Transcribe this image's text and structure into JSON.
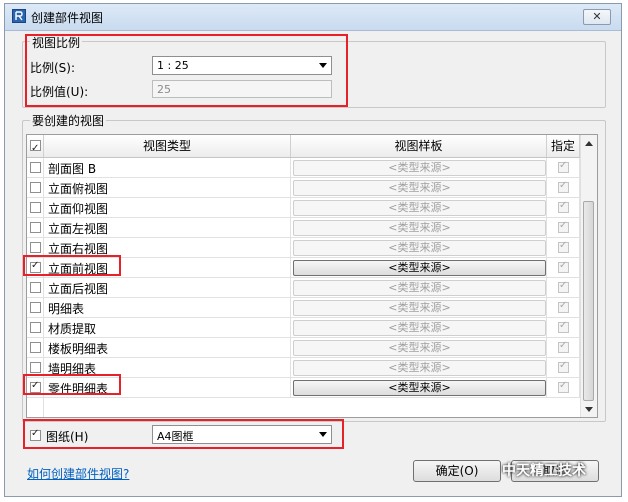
{
  "window": {
    "title": "创建部件视图",
    "close_glyph": "✕"
  },
  "scale_group": {
    "legend": "视图比例",
    "scale_label": "比例(S):",
    "scale_value": "1 : 25",
    "scale_value_label": "比例值(U):",
    "scale_value_text": "25"
  },
  "views_group": {
    "legend": "要创建的视图",
    "headers": {
      "type": "视图类型",
      "template": "视图样板",
      "specify": "指定"
    },
    "rows": [
      {
        "name": "剖面图 B",
        "checked": false,
        "template": "<类型来源>",
        "specify": true
      },
      {
        "name": "立面俯视图",
        "checked": false,
        "template": "<类型来源>",
        "specify": true
      },
      {
        "name": "立面仰视图",
        "checked": false,
        "template": "<类型来源>",
        "specify": true
      },
      {
        "name": "立面左视图",
        "checked": false,
        "template": "<类型来源>",
        "specify": true
      },
      {
        "name": "立面右视图",
        "checked": false,
        "template": "<类型来源>",
        "specify": true
      },
      {
        "name": "立面前视图",
        "checked": true,
        "template": "<类型来源>",
        "specify": true
      },
      {
        "name": "立面后视图",
        "checked": false,
        "template": "<类型来源>",
        "specify": true
      },
      {
        "name": "明细表",
        "checked": false,
        "template": "<类型来源>",
        "specify": true
      },
      {
        "name": "材质提取",
        "checked": false,
        "template": "<类型来源>",
        "specify": true
      },
      {
        "name": "楼板明细表",
        "checked": false,
        "template": "<类型来源>",
        "specify": true
      },
      {
        "name": "墙明细表",
        "checked": false,
        "template": "<类型来源>",
        "specify": true
      },
      {
        "name": "零件明细表",
        "checked": true,
        "template": "<类型来源>",
        "specify": true
      }
    ]
  },
  "sheet": {
    "checked": true,
    "label": "图纸(H)",
    "value": "A4图框"
  },
  "footer": {
    "help_link": "如何创建部件视图?",
    "ok_label": "确定(O)",
    "cancel_label": "取消",
    "watermark": "中天精工技术"
  },
  "colors": {
    "highlight_box": "#e8202a",
    "link": "#0060c0"
  }
}
